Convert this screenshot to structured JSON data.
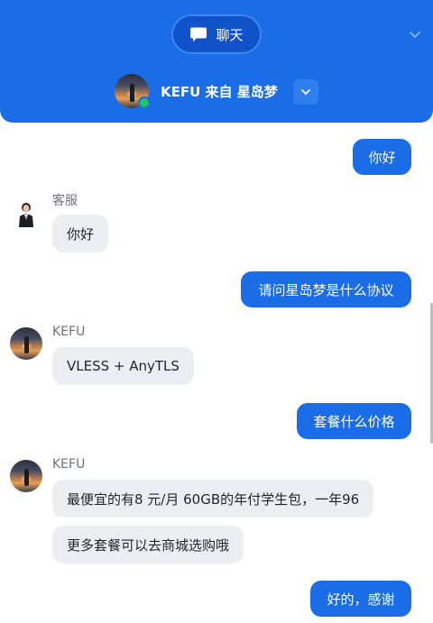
{
  "header": {
    "tab_label": "聊天",
    "agent_name": "KEFU 来自 星岛梦",
    "online": true
  },
  "colors": {
    "primary": "#1a6de6",
    "primary_dark": "#0f52c9",
    "incoming_bubble": "#eceef2",
    "online": "#22c55e"
  },
  "messages": [
    {
      "direction": "out",
      "text": "你好"
    },
    {
      "direction": "in",
      "sender": "客服",
      "avatar": "agent-figure",
      "text": "你好"
    },
    {
      "direction": "out",
      "text": "请问星岛梦是什么协议"
    },
    {
      "direction": "in",
      "sender": "KEFU",
      "avatar": "sunset-photo",
      "text": "VLESS + AnyTLS"
    },
    {
      "direction": "out",
      "text": "套餐什么价格"
    },
    {
      "direction": "in",
      "sender": "KEFU",
      "avatar": "sunset-photo",
      "text": "最便宜的有8 元/月 60GB的年付学生包，一年96"
    },
    {
      "direction": "in",
      "text": "更多套餐可以去商城选购哦"
    },
    {
      "direction": "out",
      "text": "好的，感谢"
    }
  ]
}
